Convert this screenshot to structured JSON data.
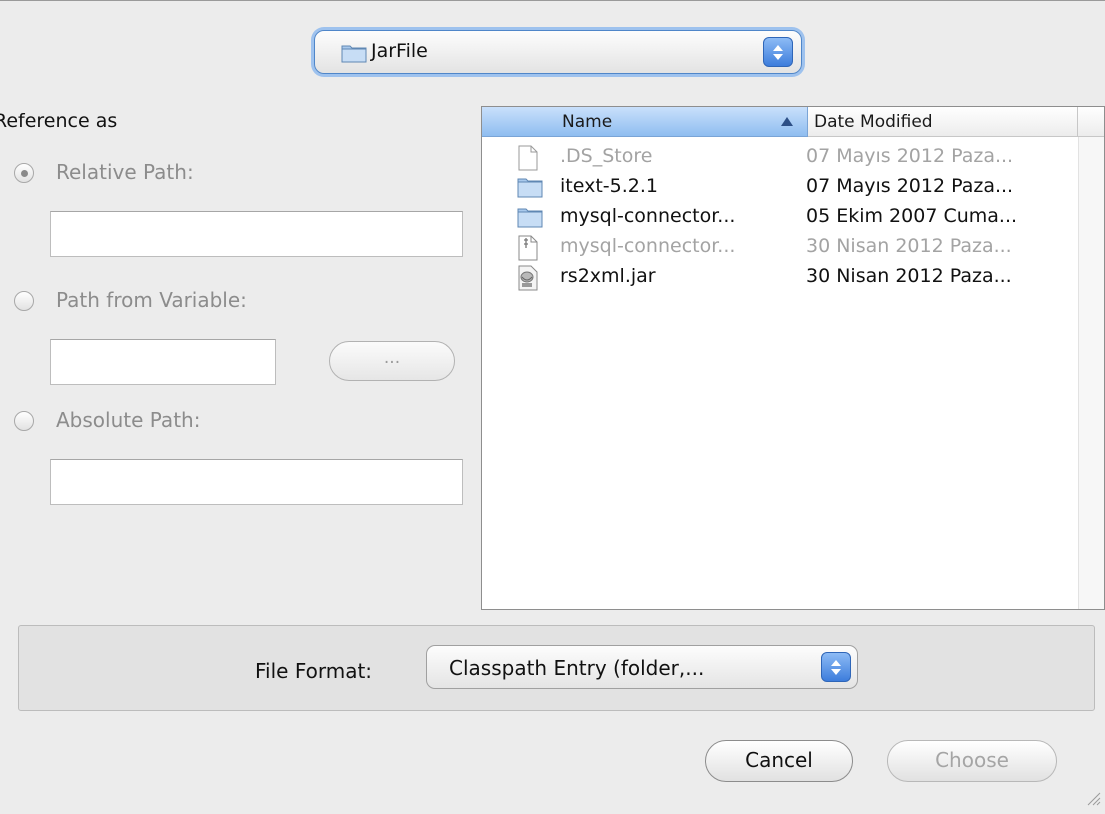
{
  "location": {
    "label": "JarFile"
  },
  "reference": {
    "title": "Reference as",
    "options": [
      {
        "label": "Relative Path:",
        "selected": true
      },
      {
        "label": "Path from Variable:",
        "selected": false
      },
      {
        "label": "Absolute Path:",
        "selected": false
      }
    ],
    "relative_value": "",
    "variable_value": "",
    "absolute_value": "",
    "browse_label": "..."
  },
  "browser": {
    "columns": {
      "name": "Name",
      "date": "Date Modified"
    },
    "sort": "ascending",
    "files": [
      {
        "name": ".DS_Store",
        "date": "07 Mayıs 2012 Paza...",
        "icon": "document-icon",
        "dimmed": true
      },
      {
        "name": "itext-5.2.1",
        "date": "07 Mayıs 2012 Paza...",
        "icon": "folder-icon",
        "dimmed": false
      },
      {
        "name": "mysql-connector...",
        "date": "05 Ekim 2007 Cuma...",
        "icon": "folder-icon",
        "dimmed": false
      },
      {
        "name": "mysql-connector...",
        "date": "30 Nisan 2012 Paza...",
        "icon": "archive-icon",
        "dimmed": true
      },
      {
        "name": "rs2xml.jar",
        "date": "30 Nisan 2012 Paza...",
        "icon": "jar-icon",
        "dimmed": false
      }
    ]
  },
  "format": {
    "label": "File Format:",
    "value": "Classpath Entry (folder,..."
  },
  "buttons": {
    "cancel": "Cancel",
    "choose": "Choose"
  },
  "colors": {
    "accent": "#8fbdf0",
    "focus_ring": "#9ec2ee",
    "stepper": "#3d7ddc"
  }
}
